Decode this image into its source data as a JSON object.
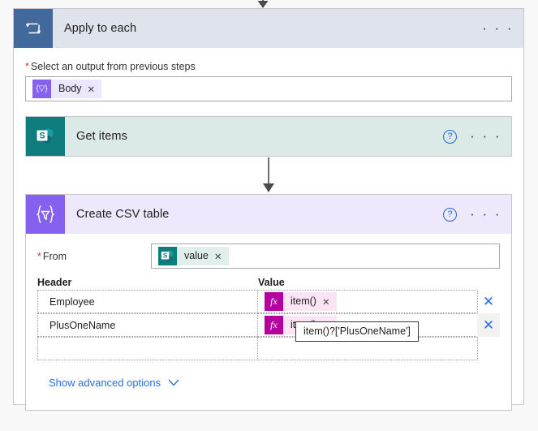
{
  "loop": {
    "title": "Apply to each",
    "icon": "loop-repeat-icon",
    "icon_color": "#41699b",
    "header_bg": "#dfe3ec",
    "more_label": "· · ·",
    "field": {
      "label": "Select an output from previous steps",
      "required_marker": "*",
      "token": {
        "icon": "dynamic-content-icon",
        "icon_glyph": "{▽}",
        "label": "Body",
        "remove": "✕",
        "accent": "#8661f0",
        "bg": "#ece7fd"
      }
    }
  },
  "get_items": {
    "title": "Get items",
    "icon": "sharepoint-icon",
    "icon_color": "#0f7d7d",
    "header_bg": "#dbe9e7",
    "help_label": "?",
    "more_label": "· · ·"
  },
  "create_csv": {
    "title": "Create CSV table",
    "icon": "data-operations-icon",
    "icon_glyph": "{▽}",
    "icon_color": "#8661f0",
    "header_bg": "#eee8fd",
    "help_label": "?",
    "more_label": "· · ·",
    "from": {
      "label": "From",
      "required_marker": "*",
      "token": {
        "icon": "sharepoint-icon",
        "label": "value",
        "remove": "✕",
        "accent": "#0f7d7d",
        "bg": "#e0eeec"
      }
    },
    "columns": {
      "header": "Header",
      "value": "Value"
    },
    "rows": [
      {
        "header": "Employee",
        "value_token": {
          "icon": "fx-icon",
          "icon_glyph": "fx",
          "label": "item()",
          "remove": "✕"
        },
        "delete_label": "✕",
        "hovered": false
      },
      {
        "header": "PlusOneName",
        "value_token": {
          "icon": "fx-icon",
          "icon_glyph": "fx",
          "label": "item()",
          "remove": "✕"
        },
        "delete_label": "✕",
        "hovered": true
      },
      {
        "header": "",
        "value_token": null,
        "delete_label": "",
        "hovered": false
      }
    ],
    "tooltip": "item()?['PlusOneName']",
    "advanced": {
      "label": "Show advanced options",
      "chevron": "chevron-down-icon"
    }
  },
  "theme": {
    "page_bg": "#f8f8f8",
    "card_border": "#c8c6c4",
    "link_blue": "#2b6fe3",
    "required_red": "#d13438",
    "arrow_gray": "#4a4a4a"
  }
}
